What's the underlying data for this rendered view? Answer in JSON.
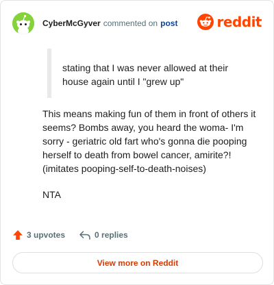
{
  "header": {
    "username": "CyberMcGyver",
    "action_text": "commented on",
    "post_link": "post",
    "logo_text": "reddit"
  },
  "comment": {
    "quote": "stating that I was never allowed at their house again until I \"grew up\"",
    "paragraphs": [
      "This means making fun of them in front of others it seems? Bombs away, you heard the woma- I'm sorry - geriatric old fart who's gonna die pooping herself to death from bowel cancer, amirite?! (imitates pooping-self-to-death-noises)",
      "NTA"
    ]
  },
  "actions": {
    "upvotes": "3 upvotes",
    "replies": "0 replies"
  },
  "footer": {
    "view_more": "View more on Reddit"
  },
  "colors": {
    "brand": "#ff4500",
    "avatar_bg": "#86d23a",
    "link": "#0a449b",
    "muted": "#576f76"
  }
}
